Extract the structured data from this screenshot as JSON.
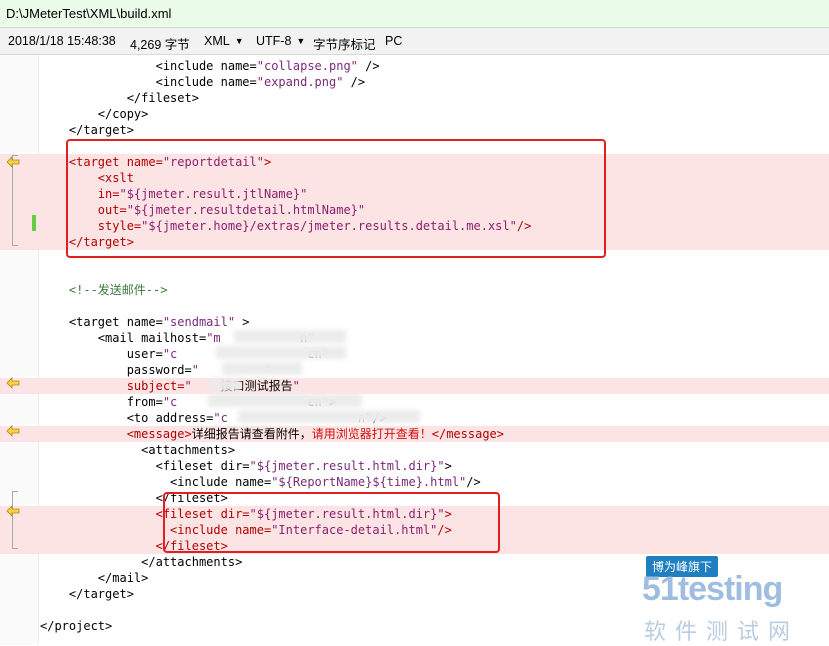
{
  "path": "D:\\JMeterTest\\XML\\build.xml",
  "info": {
    "datetime": "2018/1/18 15:48:38",
    "size": "4,269 字节",
    "language": "XML",
    "encoding": "UTF-8",
    "bom": "字节序标记",
    "eol": "PC"
  },
  "watermark": {
    "top": "博为峰旗下",
    "logo": "51testing",
    "cn": "软件测试网"
  },
  "code": [
    {
      "hl": false,
      "seg": [
        [
          "t",
          "                <include "
        ],
        [
          "a",
          "name="
        ],
        [
          "v",
          "\"collapse.png\""
        ],
        [
          "t",
          " />"
        ]
      ]
    },
    {
      "hl": false,
      "seg": [
        [
          "t",
          "                <include "
        ],
        [
          "a",
          "name="
        ],
        [
          "v",
          "\"expand.png\""
        ],
        [
          "t",
          " />"
        ]
      ]
    },
    {
      "hl": false,
      "seg": [
        [
          "t",
          "            </fileset>"
        ]
      ]
    },
    {
      "hl": false,
      "seg": [
        [
          "t",
          "        </copy>"
        ]
      ]
    },
    {
      "hl": false,
      "seg": [
        [
          "t",
          "    </target>"
        ]
      ]
    },
    {
      "hl": false,
      "seg": [
        [
          "t",
          ""
        ]
      ]
    },
    {
      "hl": true,
      "seg": [
        [
          "t",
          "    <target "
        ],
        [
          "a",
          "name="
        ],
        [
          "v",
          "\"reportdetail\""
        ],
        [
          "t",
          ">"
        ]
      ]
    },
    {
      "hl": true,
      "seg": [
        [
          "t",
          "        <xslt"
        ]
      ]
    },
    {
      "hl": true,
      "seg": [
        [
          "a",
          "        in="
        ],
        [
          "v",
          "\"${jmeter.result.jtlName}\""
        ]
      ]
    },
    {
      "hl": true,
      "seg": [
        [
          "a",
          "        out="
        ],
        [
          "v",
          "\"${jmeter.resultdetail.htmlName}\""
        ]
      ]
    },
    {
      "hl": true,
      "seg": [
        [
          "a",
          "        style="
        ],
        [
          "v",
          "\"${jmeter.home}/extras/jmeter.results.detail.me.xsl\""
        ],
        [
          "t",
          "/>"
        ]
      ]
    },
    {
      "hl": true,
      "seg": [
        [
          "t",
          "    </target>"
        ]
      ]
    },
    {
      "hl": false,
      "seg": [
        [
          "t",
          ""
        ]
      ]
    },
    {
      "hl": false,
      "seg": [
        [
          "t",
          ""
        ]
      ]
    },
    {
      "hl": false,
      "seg": [
        [
          "c",
          "    <!--发送邮件-->"
        ]
      ]
    },
    {
      "hl": false,
      "seg": [
        [
          "t",
          ""
        ]
      ]
    },
    {
      "hl": false,
      "seg": [
        [
          "t",
          "    <target "
        ],
        [
          "a",
          "name="
        ],
        [
          "v",
          "\"sendmail\""
        ],
        [
          "t",
          " >"
        ]
      ]
    },
    {
      "hl": false,
      "seg": [
        [
          "t",
          "        <mail "
        ],
        [
          "a",
          "mailhost="
        ],
        [
          "v",
          "\"m           n\""
        ]
      ]
    },
    {
      "hl": false,
      "seg": [
        [
          "a",
          "            user="
        ],
        [
          "v",
          "\"c                  cn\""
        ]
      ]
    },
    {
      "hl": false,
      "seg": [
        [
          "a",
          "            password="
        ],
        [
          "v",
          "\"         \""
        ]
      ]
    },
    {
      "hl": true,
      "seg": [
        [
          "a",
          "            subject="
        ],
        [
          "v",
          "\""
        ],
        [
          "x",
          "    接口测试报告"
        ],
        [
          "v",
          "\""
        ]
      ]
    },
    {
      "hl": false,
      "seg": [
        [
          "a",
          "            from="
        ],
        [
          "v",
          "\"c                  cn\""
        ],
        [
          "t",
          ">"
        ]
      ]
    },
    {
      "hl": false,
      "seg": [
        [
          "t",
          "            <to "
        ],
        [
          "a",
          "address="
        ],
        [
          "v",
          "\"c                  n\""
        ],
        [
          "t",
          "/>"
        ]
      ]
    },
    {
      "hl": true,
      "seg": [
        [
          "t",
          "            <message>"
        ],
        [
          "x",
          "详细报告请查看附件，"
        ],
        [
          "r",
          "请用浏览器打开查看！"
        ],
        [
          "t",
          "</message>"
        ]
      ]
    },
    {
      "hl": false,
      "seg": [
        [
          "t",
          "              <attachments>"
        ]
      ]
    },
    {
      "hl": false,
      "seg": [
        [
          "t",
          "                <fileset "
        ],
        [
          "a",
          "dir="
        ],
        [
          "v",
          "\"${jmeter.result.html.dir}\""
        ],
        [
          "t",
          ">"
        ]
      ]
    },
    {
      "hl": false,
      "seg": [
        [
          "t",
          "                  <include "
        ],
        [
          "a",
          "name="
        ],
        [
          "v",
          "\"${ReportName}${time}.html\""
        ],
        [
          "t",
          "/>"
        ]
      ]
    },
    {
      "hl": false,
      "seg": [
        [
          "t",
          "                </fileset>"
        ]
      ]
    },
    {
      "hl": true,
      "seg": [
        [
          "t",
          "                <fileset "
        ],
        [
          "a",
          "dir="
        ],
        [
          "v",
          "\"${jmeter.result.html.dir}\""
        ],
        [
          "t",
          ">"
        ]
      ]
    },
    {
      "hl": true,
      "seg": [
        [
          "t",
          "                  <include "
        ],
        [
          "a",
          "name="
        ],
        [
          "v",
          "\"Interface-detail.html\""
        ],
        [
          "t",
          "/>"
        ]
      ]
    },
    {
      "hl": true,
      "seg": [
        [
          "t",
          "                </fileset>"
        ]
      ]
    },
    {
      "hl": false,
      "seg": [
        [
          "t",
          "              </attachments>"
        ]
      ]
    },
    {
      "hl": false,
      "seg": [
        [
          "t",
          "        </mail>"
        ]
      ]
    },
    {
      "hl": false,
      "seg": [
        [
          "t",
          "    </target>"
        ]
      ]
    },
    {
      "hl": false,
      "seg": [
        [
          "t",
          ""
        ]
      ]
    },
    {
      "hl": false,
      "seg": [
        [
          "t",
          "</project>"
        ]
      ]
    }
  ]
}
